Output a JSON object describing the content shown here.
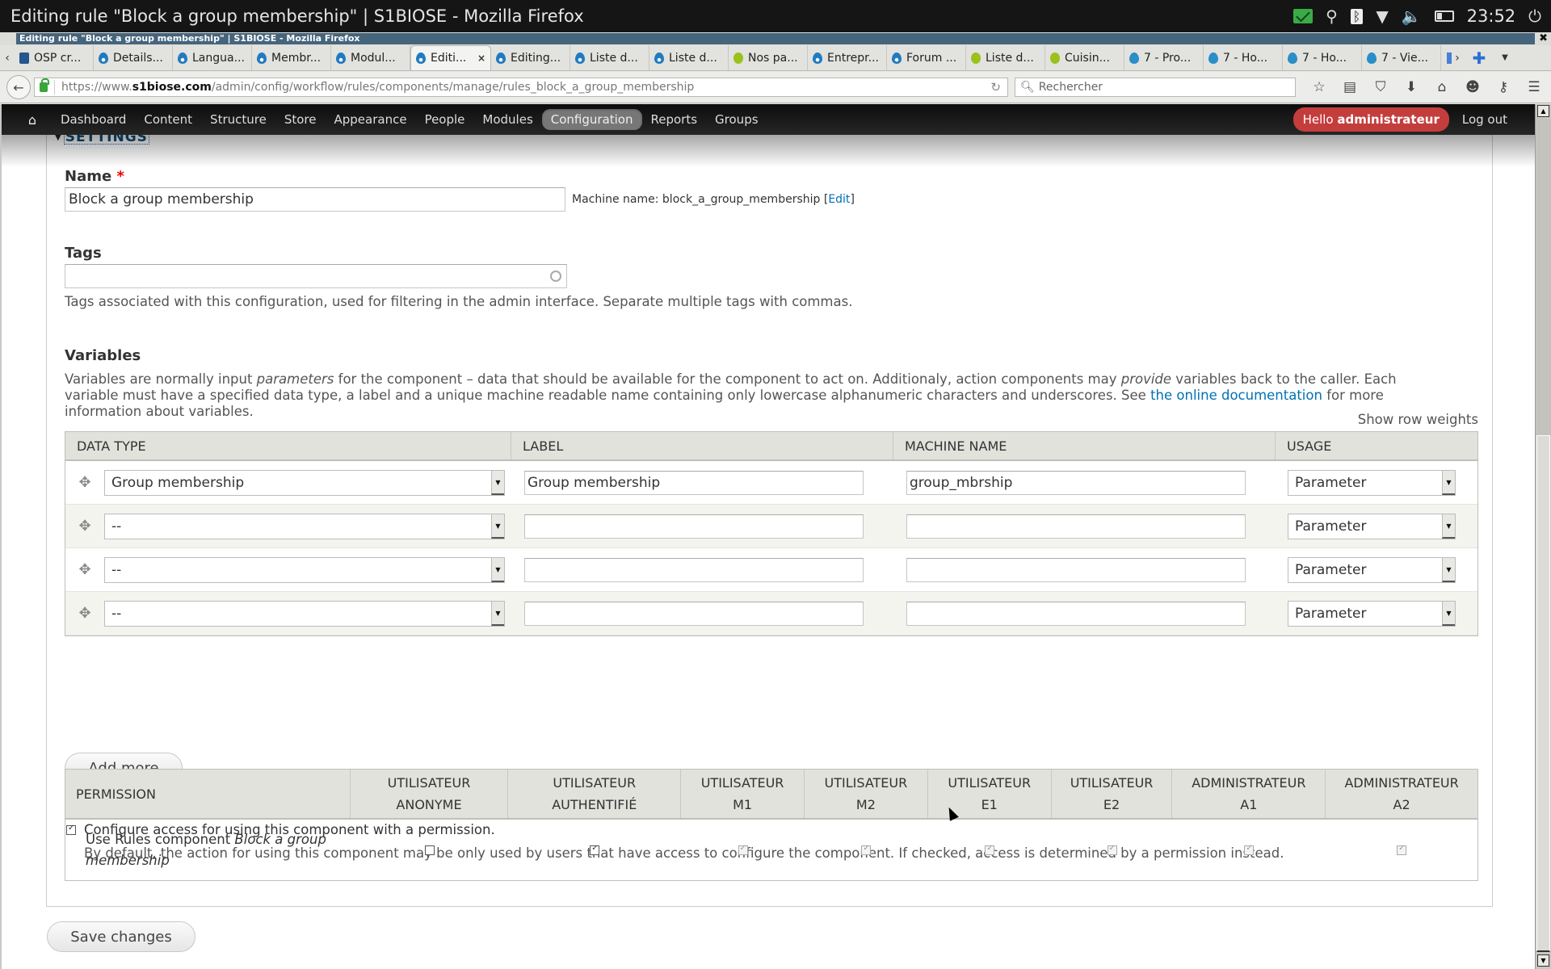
{
  "os": {
    "window_title": "Editing rule \"Block a group membership\" | S1BIOSE - Mozilla Firefox",
    "clock": "23:52",
    "tray_icons": [
      "mail-icon",
      "location-icon",
      "bluetooth-icon",
      "wifi-icon",
      "volume-icon",
      "battery-icon",
      "power-icon"
    ]
  },
  "window": {
    "title": "Editing rule \"Block a group membership\" | S1BIOSE - Mozilla Firefox",
    "close_glyph": "✖"
  },
  "tabs": [
    {
      "label": "OSP cr...",
      "icon": "osp"
    },
    {
      "label": "Details...",
      "icon": "drupal"
    },
    {
      "label": "Langua...",
      "icon": "drupal"
    },
    {
      "label": "Membr...",
      "icon": "drupal"
    },
    {
      "label": "Modul...",
      "icon": "drupal"
    },
    {
      "label": "Editi...",
      "icon": "drupal",
      "active": true
    },
    {
      "label": "Editing...",
      "icon": "drupal"
    },
    {
      "label": "Liste d...",
      "icon": "drupal"
    },
    {
      "label": "Liste d...",
      "icon": "drupal"
    },
    {
      "label": "Nos pa...",
      "icon": "green"
    },
    {
      "label": "Entrepr...",
      "icon": "drupal"
    },
    {
      "label": "Forum ...",
      "icon": "drupal"
    },
    {
      "label": "Liste d...",
      "icon": "green"
    },
    {
      "label": "Cuisin...",
      "icon": "green"
    },
    {
      "label": "7 - Pro...",
      "icon": "drop"
    },
    {
      "label": "7 - Ho...",
      "icon": "drop"
    },
    {
      "label": "7 - Ho...",
      "icon": "drop"
    },
    {
      "label": "7 - Vie...",
      "icon": "drop"
    }
  ],
  "tab_close": "×",
  "urlbar": {
    "url_prefix": "https://www.",
    "url_domain": "s1biose.com",
    "url_path": "/admin/config/workflow/rules/components/manage/rules_block_a_group_membership",
    "search_placeholder": "Rechercher"
  },
  "admin_toolbar": {
    "items": [
      "Dashboard",
      "Content",
      "Structure",
      "Store",
      "Appearance",
      "People",
      "Modules",
      "Configuration",
      "Reports",
      "Groups"
    ],
    "active": "Configuration",
    "hello_prefix": "Hello ",
    "username": "administrateur",
    "logout": "Log out"
  },
  "settings": {
    "legend": "SETTINGS",
    "name_label": "Name",
    "required_mark": "*",
    "name_value": "Block a group membership",
    "machine_name_prefix": "Machine name: block_a_group_membership [",
    "machine_name_edit": "Edit",
    "machine_name_suffix": "]",
    "tags_label": "Tags",
    "tags_value": "",
    "tags_description": "Tags associated with this configuration, used for filtering in the admin interface. Separate multiple tags with commas."
  },
  "variables": {
    "heading": "Variables",
    "desc_1": "Variables are normally input ",
    "desc_em1": "parameters",
    "desc_2": " for the component – data that should be available for the component to act on. Additionaly, action components may ",
    "desc_em2": "provide",
    "desc_3": " variables back to the caller. Each variable must have a specified data type, a label and a unique machine readable name containing only lowercase alphanumeric characters and underscores. See ",
    "desc_link": "the online documentation",
    "desc_4": " for more information about variables.",
    "show_row_weights": "Show row weights",
    "columns": [
      "DATA TYPE",
      "LABEL",
      "MACHINE NAME",
      "USAGE"
    ],
    "rows": [
      {
        "data_type": "Group membership",
        "label": "Group membership",
        "machine_name": "group_mbrship",
        "usage": "Parameter"
      },
      {
        "data_type": "--",
        "label": "",
        "machine_name": "",
        "usage": "Parameter"
      },
      {
        "data_type": "--",
        "label": "",
        "machine_name": "",
        "usage": "Parameter"
      },
      {
        "data_type": "--",
        "label": "",
        "machine_name": "",
        "usage": "Parameter"
      }
    ],
    "add_more": "Add more"
  },
  "access": {
    "checkbox_label": "Configure access for using this component with a permission.",
    "checked": true,
    "description": "By default, the action for using this component may be only used by users that have access to configure the component. If checked, access is determined by a permission instead.",
    "columns": [
      {
        "line1": "PERMISSION",
        "line2": ""
      },
      {
        "line1": "UTILISATEUR",
        "line2": "ANONYME"
      },
      {
        "line1": "UTILISATEUR",
        "line2": "AUTHENTIFIÉ"
      },
      {
        "line1": "UTILISATEUR",
        "line2": "M1"
      },
      {
        "line1": "UTILISATEUR",
        "line2": "M2"
      },
      {
        "line1": "UTILISATEUR",
        "line2": "E1"
      },
      {
        "line1": "UTILISATEUR",
        "line2": "E2"
      },
      {
        "line1": "ADMINISTRATEUR",
        "line2": "A1"
      },
      {
        "line1": "ADMINISTRATEUR",
        "line2": "A2"
      }
    ],
    "permission_row": {
      "prefix": "Use Rules component ",
      "name_em": "Block a group membership",
      "values": [
        {
          "role": "anonyme",
          "state": "unchecked"
        },
        {
          "role": "authentifie",
          "state": "checked"
        },
        {
          "role": "m1",
          "state": "checked-disabled"
        },
        {
          "role": "m2",
          "state": "checked-disabled"
        },
        {
          "role": "e1",
          "state": "checked-disabled"
        },
        {
          "role": "e2",
          "state": "checked-disabled"
        },
        {
          "role": "a1",
          "state": "checked-disabled"
        },
        {
          "role": "a2",
          "state": "checked-disabled"
        }
      ]
    }
  },
  "save_button": "Save changes",
  "colors": {
    "link": "#0071b3",
    "hello_badge": "#c43d3d",
    "legend": "#0e4b76",
    "table_header": "#e1e2dc"
  }
}
